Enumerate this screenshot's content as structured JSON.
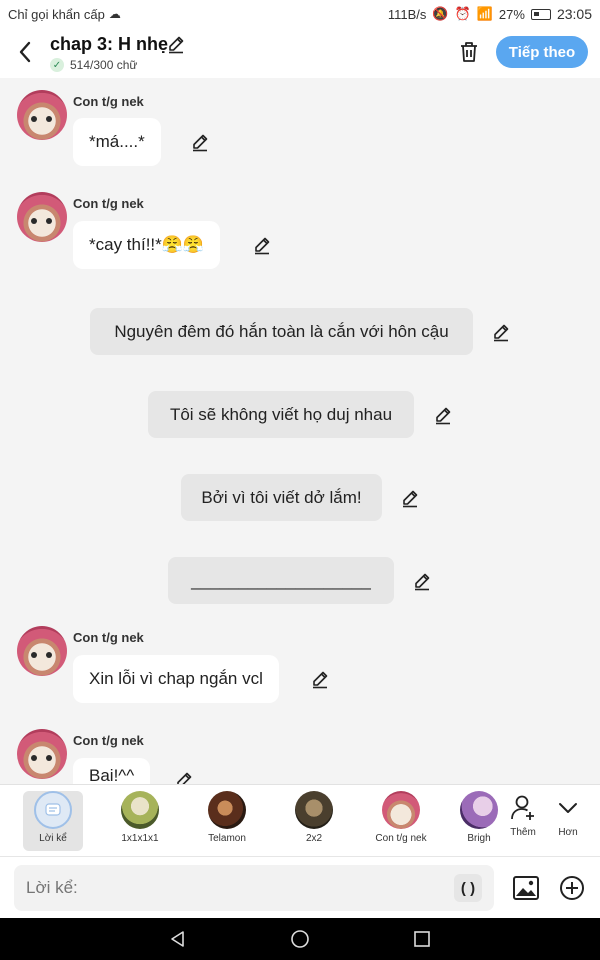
{
  "status_bar": {
    "left_text": "Chỉ gọi khẩn cấp",
    "speed": "111B/s",
    "battery": "27%",
    "time": "23:05"
  },
  "header": {
    "title": "chap 3: H nhẹ",
    "word_count": "514/300 chữ",
    "next_label": "Tiếp theo"
  },
  "character_name": "Con t/g nek",
  "messages": [
    {
      "type": "char",
      "text": "*má....*"
    },
    {
      "type": "char",
      "text": "*cay thí!!*😤😤"
    },
    {
      "type": "narr",
      "text": "Nguyên đêm đó hắn toàn là cắn với hôn cậu"
    },
    {
      "type": "narr",
      "text": "Tôi sẽ không viết họ duj nhau"
    },
    {
      "type": "narr",
      "text": "Bởi vì tôi viết dở lắm!"
    },
    {
      "type": "narr",
      "text": "___________________"
    },
    {
      "type": "char",
      "text": "Xin lỗi vì chap ngắn vcl"
    },
    {
      "type": "char",
      "text": "Bai!^^"
    }
  ],
  "characters": [
    {
      "name": "Lời kể",
      "icon": "narrator-icon",
      "active": true
    },
    {
      "name": "1x1x1x1"
    },
    {
      "name": "Telamon"
    },
    {
      "name": "2x2"
    },
    {
      "name": "Con t/g nek"
    },
    {
      "name": "Brigh"
    }
  ],
  "tools": {
    "add_character": "Thêm",
    "more": "Hơn"
  },
  "input": {
    "placeholder": "Lời kể:",
    "paren_label": "( )"
  },
  "colors": {
    "accent": "#5aa7f0",
    "background": "#f4f4f4",
    "narration_bg": "#e6e6e6"
  }
}
